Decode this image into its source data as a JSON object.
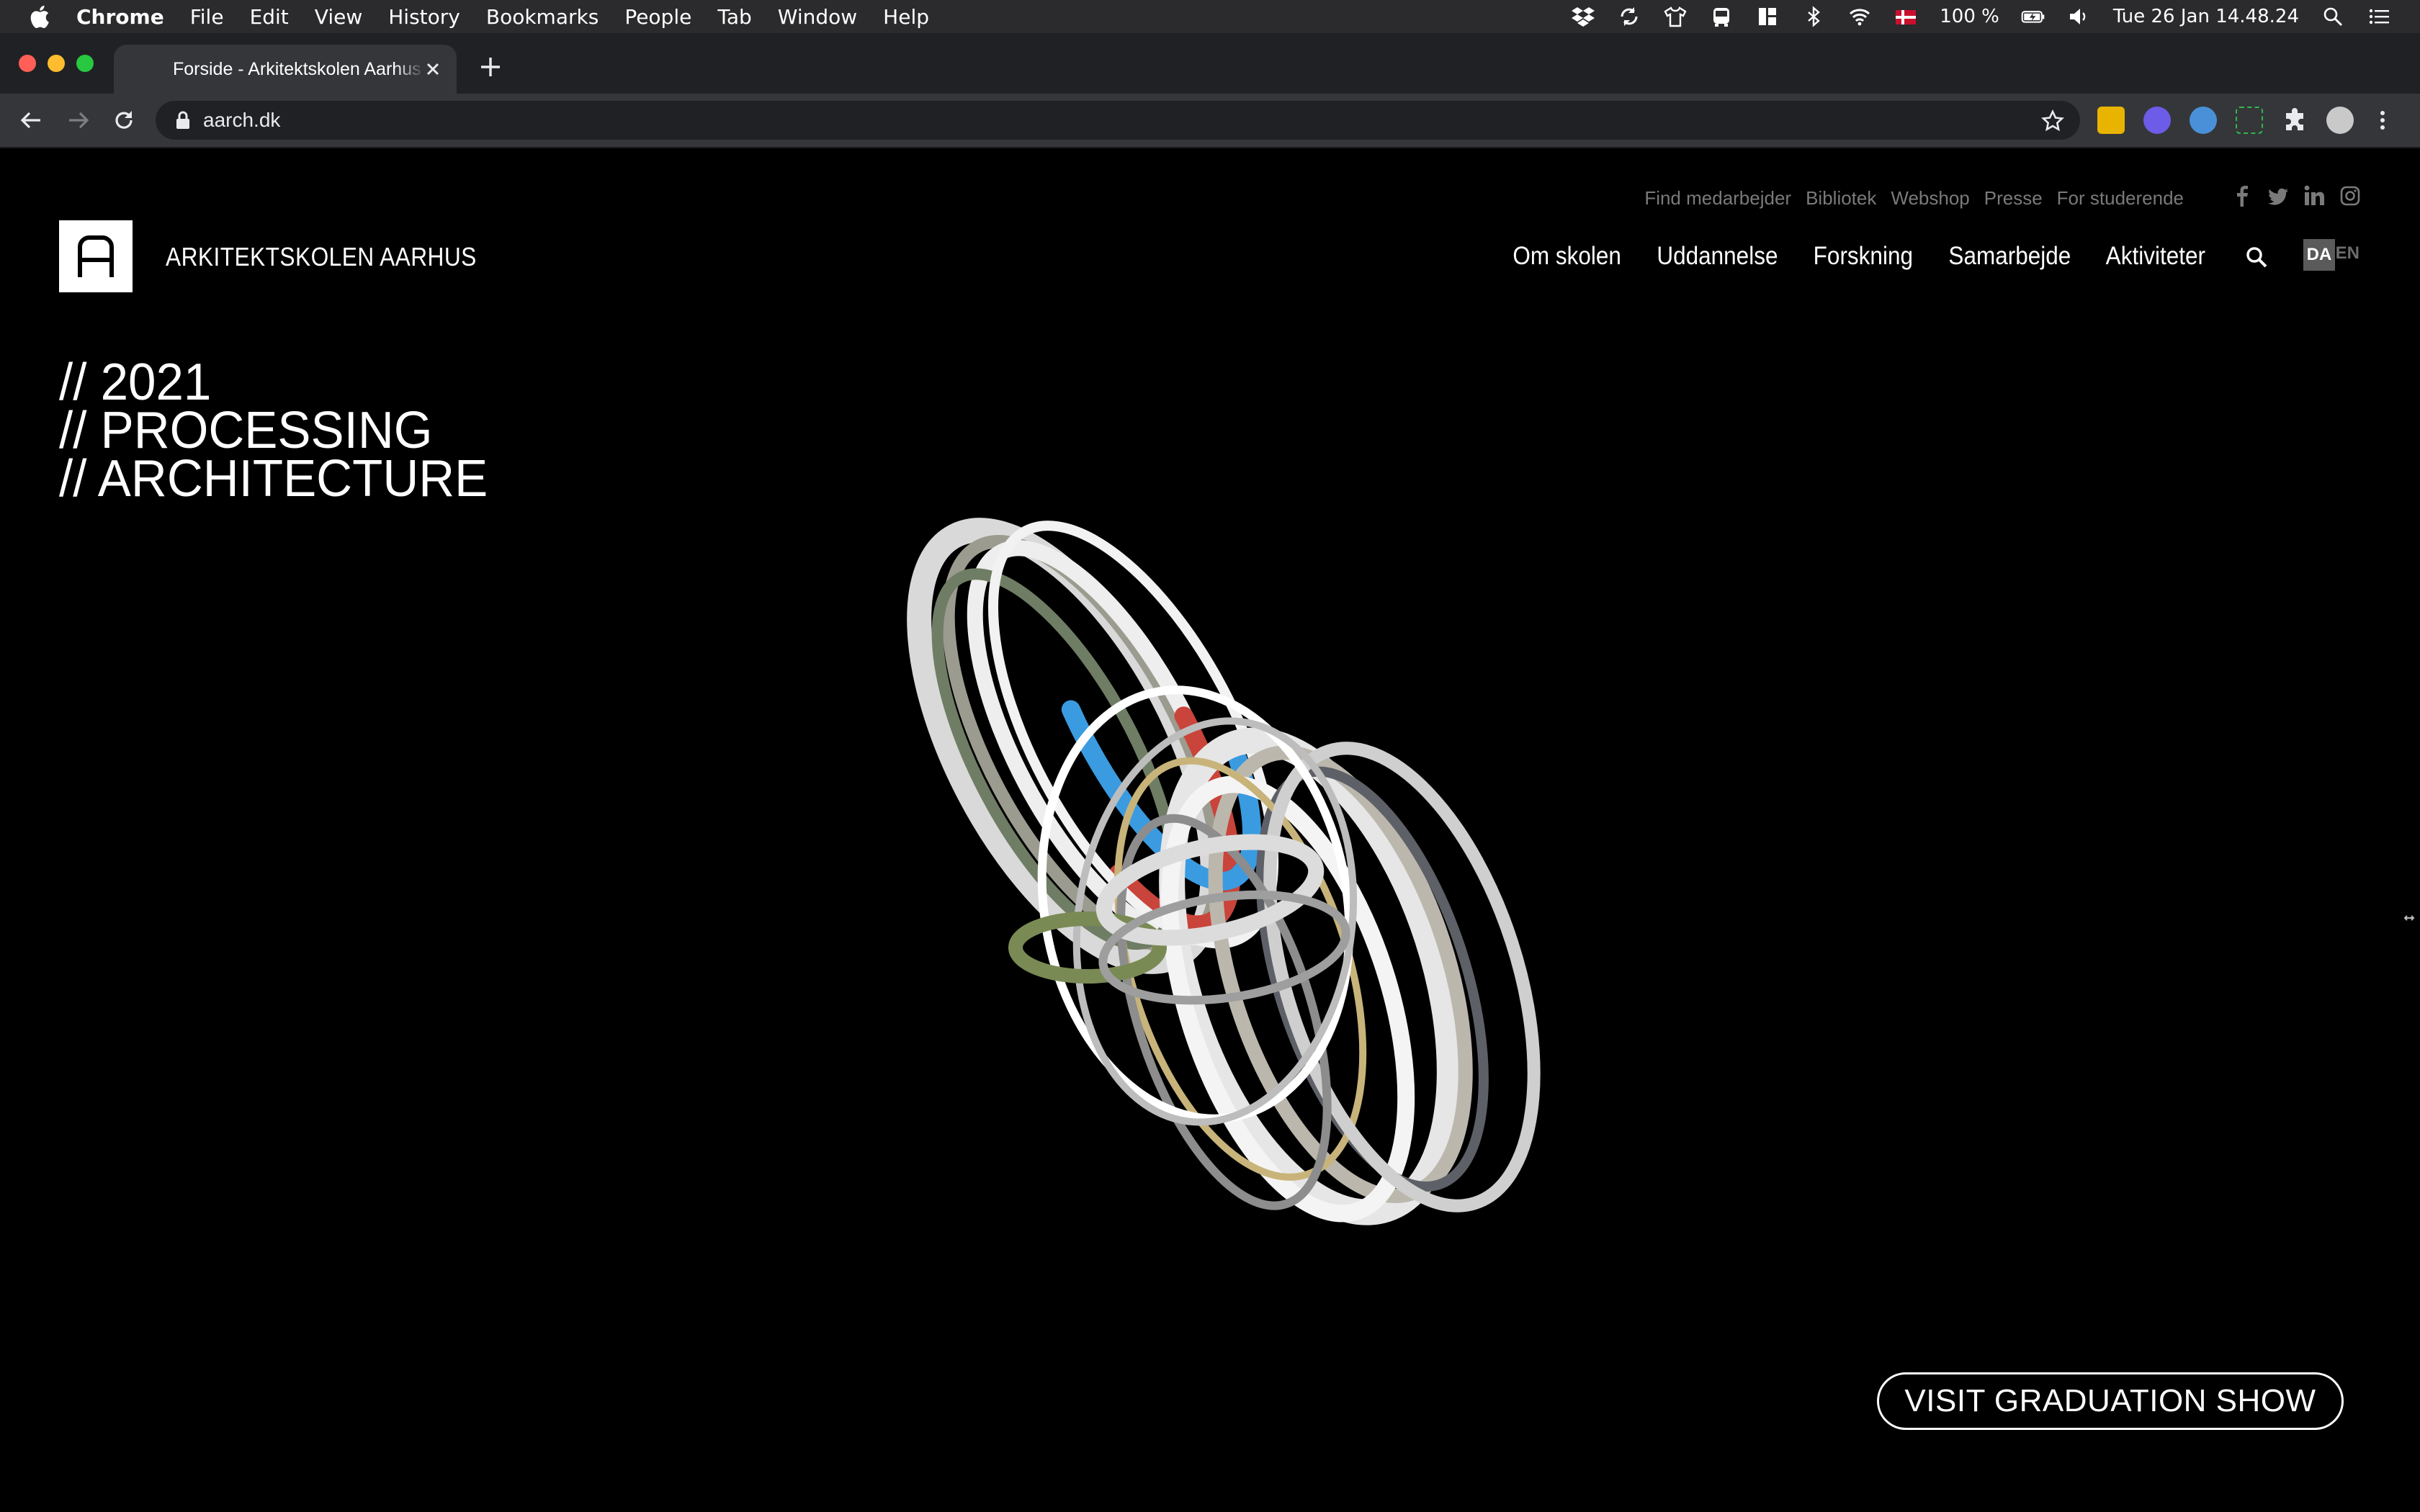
{
  "menubar": {
    "items": [
      "Chrome",
      "File",
      "Edit",
      "View",
      "History",
      "Bookmarks",
      "People",
      "Tab",
      "Window",
      "Help"
    ],
    "battery": "100 %",
    "clock": "Tue 26 Jan  14.48.24"
  },
  "browser": {
    "tab_title": "Forside - Arkitektskolen Aarhus",
    "url": "aarch.dk"
  },
  "site": {
    "logo_text": "ARKITEKTSKOLEN AARHUS",
    "utility_links": [
      "Find medarbejder",
      "Bibliotek",
      "Webshop",
      "Presse",
      "For studerende"
    ],
    "main_nav": [
      "Om skolen",
      "Uddannelse",
      "Forskning",
      "Samarbejde",
      "Aktiviteter"
    ],
    "lang_active": "DA",
    "lang_other": "EN",
    "hero_lines": [
      "// 2021",
      "// PROCESSING",
      "// ARCHITECTURE"
    ],
    "cta": "VISIT GRADUATION SHOW"
  },
  "colors": {
    "page_bg": "#000000",
    "menubar_bg": "#2b2a2c",
    "tabstrip_bg": "#202124",
    "toolbar_bg": "#35363a",
    "utility_link": "#7a7a7a",
    "accent_red": "#c9443a",
    "accent_blue": "#3a9be0"
  }
}
